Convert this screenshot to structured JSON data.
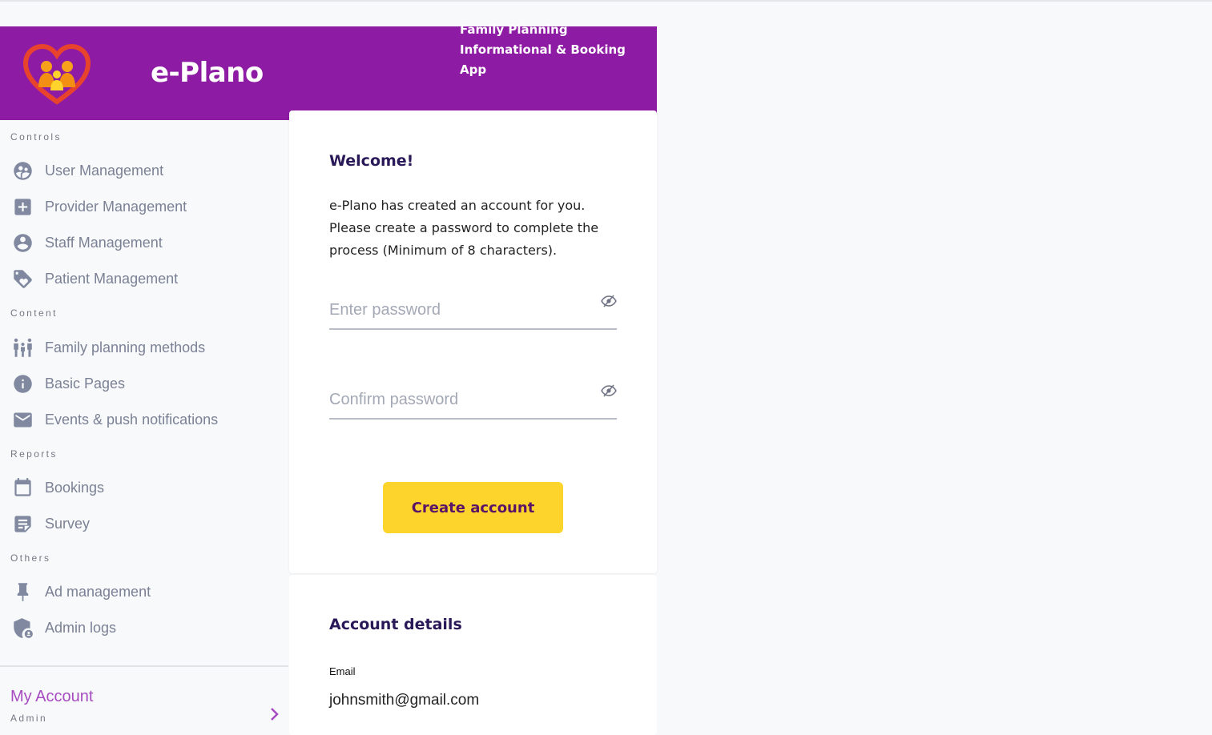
{
  "header": {
    "app_title": "e-Plano",
    "tagline": "Family Planning Informational & Booking App",
    "brand_color": "#8e1ba3"
  },
  "sidebar": {
    "sections": [
      {
        "title": "Controls",
        "items": [
          {
            "label": "User Management",
            "icon": "users-icon"
          },
          {
            "label": "Provider Management",
            "icon": "plus-box-icon"
          },
          {
            "label": "Staff Management",
            "icon": "account-circle-icon"
          },
          {
            "label": "Patient Management",
            "icon": "tag-heart-icon"
          }
        ]
      },
      {
        "title": "Content",
        "items": [
          {
            "label": "Family planning methods",
            "icon": "family-icon"
          },
          {
            "label": "Basic Pages",
            "icon": "info-icon"
          },
          {
            "label": "Events & push notifications",
            "icon": "mail-icon"
          }
        ]
      },
      {
        "title": "Reports",
        "items": [
          {
            "label": "Bookings",
            "icon": "calendar-icon"
          },
          {
            "label": "Survey",
            "icon": "form-icon"
          }
        ]
      },
      {
        "title": "Others",
        "items": [
          {
            "label": "Ad management",
            "icon": "pin-icon"
          },
          {
            "label": "Admin logs",
            "icon": "shield-account-icon"
          }
        ]
      }
    ],
    "account": {
      "label": "My Account",
      "role": "Admin",
      "accent": "#a64cc0"
    }
  },
  "welcome_card": {
    "heading": "Welcome!",
    "message": "e-Plano has created an account for you. Please create a password to complete the process (Minimum of 8 characters).",
    "password_placeholder": "Enter password",
    "confirm_placeholder": "Confirm password",
    "submit_label": "Create account",
    "button_color": "#fcd42b"
  },
  "details_card": {
    "heading": "Account details",
    "email_label": "Email",
    "email_value": "johnsmith@gmail.com"
  }
}
